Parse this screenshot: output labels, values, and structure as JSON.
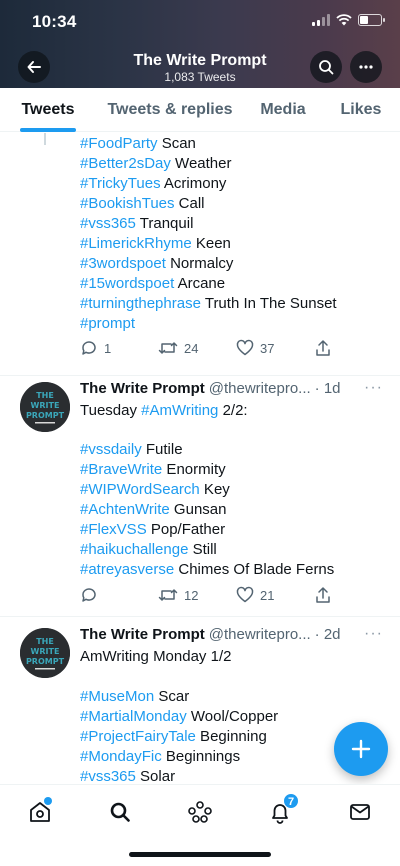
{
  "status_bar": {
    "time": "10:34"
  },
  "header": {
    "title": "The Write Prompt",
    "subtitle": "1,083 Tweets"
  },
  "tabs": [
    {
      "label": "Tweets",
      "active": true
    },
    {
      "label": "Tweets & replies",
      "active": false
    },
    {
      "label": "Media",
      "active": false
    },
    {
      "label": "Likes",
      "active": false
    }
  ],
  "tweet0": {
    "lines": [
      [
        "#FoodParty",
        " Scan"
      ],
      [
        "#Better2sDay",
        " Weather"
      ],
      [
        "#TrickyTues",
        " Acrimony"
      ],
      [
        "#BookishTues",
        " Call"
      ],
      [
        "#vss365",
        " Tranquil"
      ],
      [
        "#LimerickRhyme",
        " Keen"
      ],
      [
        "#3wordspoet",
        " Normalcy"
      ],
      [
        "#15wordspoet",
        " Arcane"
      ],
      [
        "#turningthephrase",
        " Truth In The Sunset"
      ],
      [
        "#prompt",
        ""
      ]
    ],
    "replies": "1",
    "retweets": "24",
    "likes": "37"
  },
  "tweet1": {
    "name": "The Write Prompt",
    "handle": "@thewritepro...",
    "time": "· 1d",
    "intro_pre": "Tuesday ",
    "intro_tag": "#AmWriting",
    "intro_post": " 2/2:",
    "lines": [
      [
        "#vssdaily",
        " Futile"
      ],
      [
        "#BraveWrite",
        " Enormity"
      ],
      [
        "#WIPWordSearch",
        " Key"
      ],
      [
        "#AchtenWrite",
        " Gunsan"
      ],
      [
        "#FlexVSS",
        " Pop/Father"
      ],
      [
        "#haikuchallenge",
        " Still"
      ],
      [
        "#atreyasverse",
        " Chimes Of Blade Ferns"
      ]
    ],
    "replies": "",
    "retweets": "12",
    "likes": "21"
  },
  "tweet2": {
    "name": "The Write Prompt",
    "handle": "@thewritepro...",
    "time": "· 2d",
    "intro": "AmWriting Monday 1/2",
    "lines": [
      [
        "#MuseMon",
        " Scar"
      ],
      [
        "#MartialMonday",
        " Wool/Copper"
      ],
      [
        "#ProjectFairyTale",
        " Beginning"
      ],
      [
        "#MondayFic",
        " Beginnings"
      ],
      [
        "#vss365",
        " Solar"
      ]
    ]
  },
  "avatar_text": [
    "THE",
    "WRITE",
    "PROMPT"
  ],
  "notifications_badge": "7",
  "icons": {
    "back": "arrow-left-icon",
    "search": "search-icon",
    "more": "more-horizontal-icon",
    "reply": "reply-icon",
    "retweet": "retweet-icon",
    "like": "heart-icon",
    "share": "share-icon",
    "compose": "plus-icon",
    "home": "home-icon",
    "explore": "search-icon",
    "spaces": "spaces-icon",
    "notifications": "bell-icon",
    "messages": "mail-icon"
  },
  "colors": {
    "accent": "#1d9bf0",
    "text": "#0f1419",
    "muted": "#536471"
  }
}
